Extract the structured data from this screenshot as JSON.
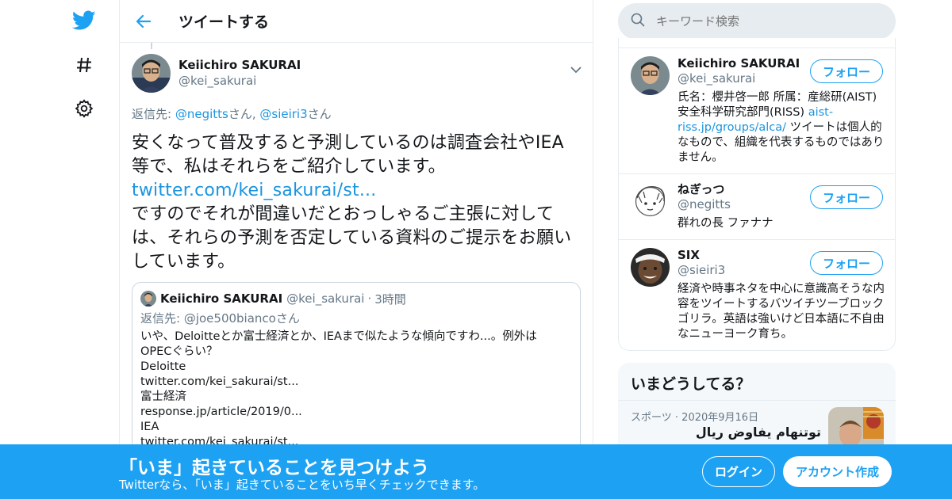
{
  "colors": {
    "accent": "#1da1f2",
    "link": "#1b95e0",
    "text": "#14171a",
    "muted": "#657786",
    "border": "#e6ecf0"
  },
  "nav": {
    "items": [
      {
        "icon": "twitter-bird-icon"
      },
      {
        "icon": "hashtag-icon"
      },
      {
        "icon": "gear-icon"
      }
    ]
  },
  "header": {
    "back_icon": "arrow-left-icon",
    "title": "ツイートする"
  },
  "tweet": {
    "author_name": "Keiichiro SAKURAI",
    "author_handle": "@kei_sakurai",
    "reply_prefix": "返信先: ",
    "reply_user1": "@negitts",
    "reply_mid": "さん, ",
    "reply_user2": "@sieiri3",
    "reply_suffix": "さん",
    "text_part1": "安くなって普及すると予測しているのは調査会社やIEA等で、私はそれらをご紹介しています。",
    "text_link": "twitter.com/kei_sakurai/st...",
    "text_part2": "ですのでそれが間違いだとおっしゃるご主張に対しては、それらの予測を否定している資料のご提示をお願いしています。"
  },
  "quote": {
    "author_name": "Keiichiro SAKURAI",
    "author_handle": "@kei_sakurai",
    "separator": "·",
    "time": "3時間",
    "reply_prefix": "返信先: ",
    "reply_user": "@joe500bianco",
    "reply_suffix": "さん",
    "lines": [
      "いや、Deloitteとか富士経済とか、IEAまで似たような傾向ですわ...。例外は",
      "OPECぐらい？",
      "Deloitte",
      "twitter.com/kei_sakurai/st...",
      "富士経済",
      "response.jp/article/2019/0...",
      "IEA",
      "twitter.com/kei_sakurai/st..."
    ]
  },
  "search": {
    "placeholder": "キーワード検索"
  },
  "users": [
    {
      "name": "Keiichiro SAKURAI",
      "handle": "@kei_sakurai",
      "follow_label": "フォロー",
      "bio_part1": "氏名：櫻井啓一郎 所属：産総研(AIST)安全科学研究部門(RISS) ",
      "bio_link": "aist-riss.jp/groups/alca/",
      "bio_part2": " ツイートは個人的なもので、組織を代表するものではありません。"
    },
    {
      "name": "ねぎっつ",
      "handle": "@negitts",
      "follow_label": "フォロー",
      "bio": "群れの長 ファナナ"
    },
    {
      "name": "SIX",
      "handle": "@sieiri3",
      "follow_label": "フォロー",
      "bio": "経済や時事ネタを中心に意識高そうな内容をツイートするバツイチツーブロックゴリラ。英語は強いけど日本語に不自由なニューヨーク育ち。"
    }
  ],
  "trends": {
    "title": "いまどうしてる？",
    "category": "スポーツ",
    "separator": "·",
    "date": "2020年9月16日",
    "headline": "توتنهام يفاوض ريال مدريد"
  },
  "banner": {
    "title": "「いま」起きていることを見つけよう",
    "subtitle": "Twitterなら、「いま」起きていることをいち早くチェックできます。",
    "login_label": "ログイン",
    "signup_label": "アカウント作成"
  }
}
